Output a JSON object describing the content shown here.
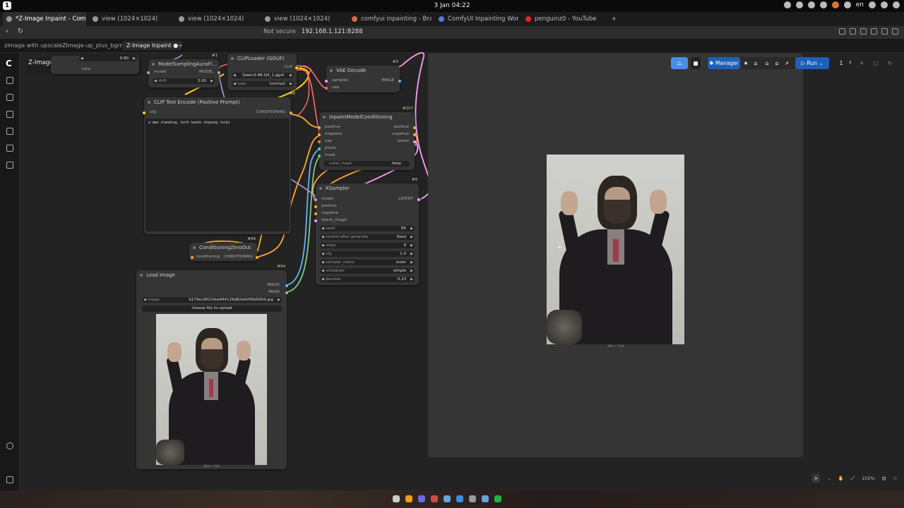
{
  "os": {
    "clock": "3 Jan 04:22",
    "lang": "en"
  },
  "browser": {
    "tabs": [
      {
        "title": "*Z-Image Inpaint - Com",
        "active": true
      },
      {
        "title": "view (1024×1024)"
      },
      {
        "title": "view (1024×1024)"
      },
      {
        "title": "view (1024×1024)"
      },
      {
        "title": "comfyui inpainting - Brave"
      },
      {
        "title": "ComfyUI Inpainting Workfl"
      },
      {
        "title": "penguinz0 - YouTube"
      }
    ],
    "new_tab": "+",
    "security": "Not secure",
    "url": "192.168.1.121:8288"
  },
  "workflow_tabs": [
    {
      "label": "zimage with upscale"
    },
    {
      "label": "ZImage-up_plus_bgrm"
    },
    {
      "label": "Z-Image Inpaint",
      "active": true
    }
  ],
  "workflow_tab_add": "+",
  "workflow_name": "Z-Image Inpaint",
  "toolbar": {
    "manager": "Manager",
    "run": "Run",
    "queue_count": "1"
  },
  "nodes": {
    "lora_stub": {
      "value": "0.80",
      "label": "Lora"
    },
    "model_sampling": {
      "id": "#1",
      "title": "ModelSamplingAuraFl...",
      "in": "model",
      "out": "MODEL",
      "shift_label": "shift",
      "shift_value": "3.00"
    },
    "clip_loader": {
      "id": "#6",
      "title": "CLIPLoader (GGUF)",
      "out": "CLIP",
      "clip_name": "Qwen3-4B-Q4_1.gguf",
      "type_label": "type",
      "type_value": "lumina2"
    },
    "vae_decode": {
      "id": "#3",
      "title": "VAE Decode",
      "in1": "samples",
      "in2": "vae",
      "out": "IMAGE"
    },
    "clip_text": {
      "title": "CLIP Text Encode (Positive Prompt)",
      "in": "clip",
      "out": "CONDITIONING",
      "prompt": "a man standing, both hands showing rocks"
    },
    "inpaint": {
      "id": "#107",
      "title": "InpaintModelConditioning",
      "ins": [
        "positive",
        "negative",
        "vae",
        "pixels",
        "mask"
      ],
      "outs": [
        "positive",
        "negative",
        "latent"
      ],
      "noise_label": "noise_mask",
      "noise_value": "false"
    },
    "ksampler": {
      "id": "#9",
      "title": "KSampler",
      "ins": [
        "model",
        "positive",
        "negative",
        "latent_image"
      ],
      "out": "LATENT",
      "widgets": [
        {
          "label": "seed",
          "value": "85"
        },
        {
          "label": "control after generate",
          "value": "fixed"
        },
        {
          "label": "steps",
          "value": "9"
        },
        {
          "label": "cfg",
          "value": "1.0"
        },
        {
          "label": "sampler_name",
          "value": "euler"
        },
        {
          "label": "scheduler",
          "value": "simple"
        },
        {
          "label": "denoise",
          "value": "0.23"
        }
      ]
    },
    "zero_out": {
      "id": "#99",
      "title": "ConditioningZeroOut",
      "in": "conditioning",
      "out": "CONDITIONING"
    },
    "load_image": {
      "id": "#94",
      "title": "Load Image",
      "out1": "IMAGE",
      "out2": "MASK",
      "image_label": "image",
      "image_value": "b179ec9021fea944129d82eb095b92b9.jpg",
      "upload": "choose file to upload",
      "dims": "369 × 500"
    }
  },
  "preview": {
    "dims": "384 × 528"
  },
  "zoom": "102%",
  "colors": {
    "accent": "#4a8fe7",
    "clip_wire": "#ffd500",
    "cond_wire": "#ffa931",
    "model_wire": "#b39ddb",
    "vae_wire": "#ff6e6e",
    "latent_wire": "#ff9cf9",
    "image_wire": "#64b5f6",
    "mask_wire": "#81c784"
  }
}
